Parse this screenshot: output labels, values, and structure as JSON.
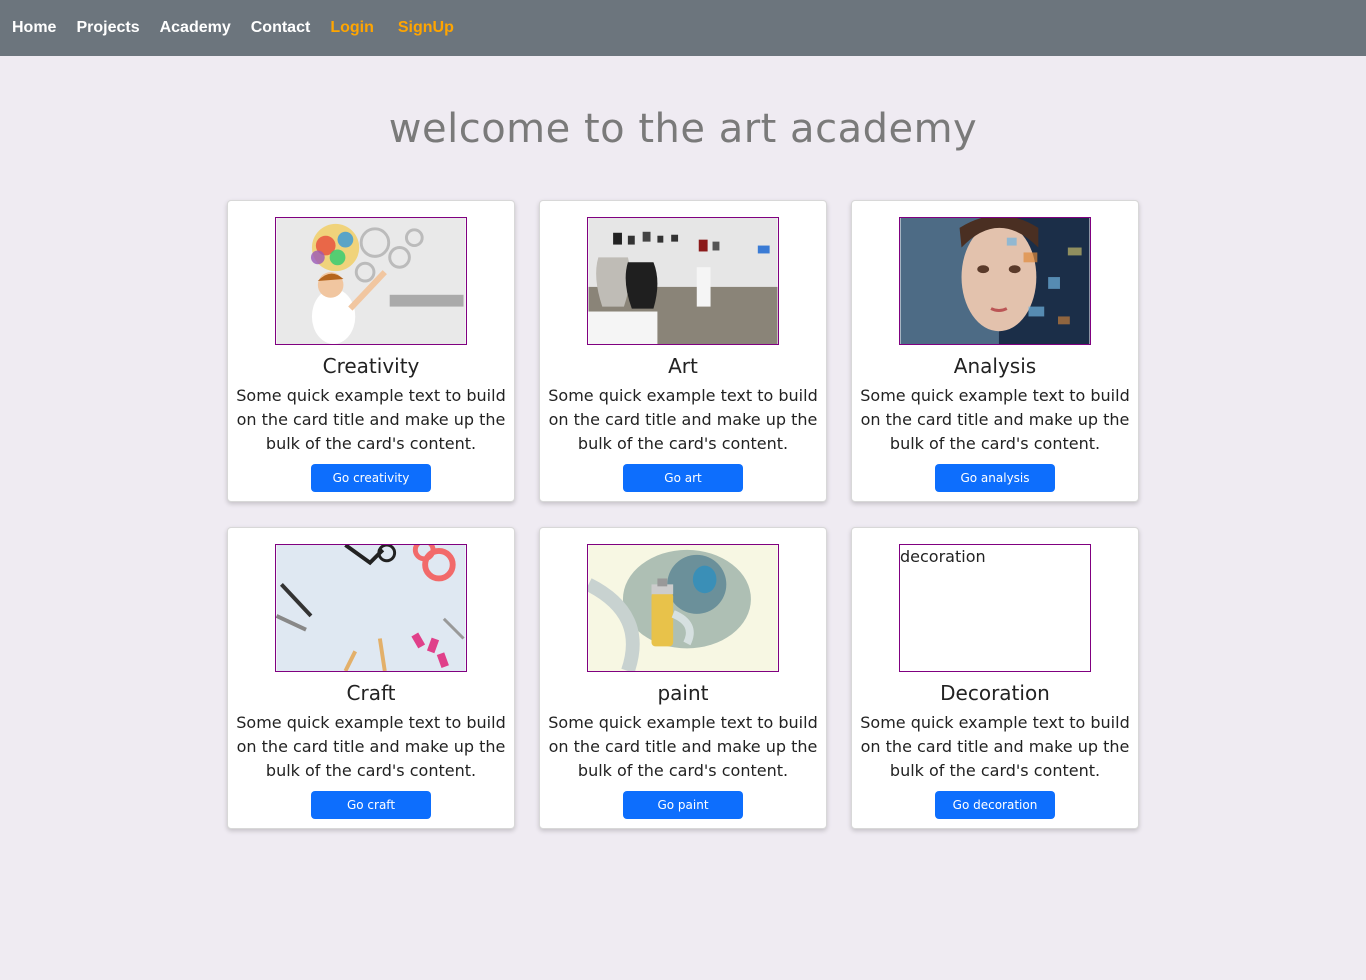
{
  "nav": {
    "items": [
      {
        "label": "Home"
      },
      {
        "label": "Projects"
      },
      {
        "label": "Academy"
      },
      {
        "label": "Contact"
      },
      {
        "label": "Login"
      },
      {
        "label": "SignUp"
      }
    ]
  },
  "page": {
    "title": "welcome to the art academy"
  },
  "cards": [
    {
      "title": "Creativity",
      "text": "Some quick example text to build on the card title and make up the bulk of the card's content.",
      "button": "Go creativity"
    },
    {
      "title": "Art",
      "text": "Some quick example text to build on the card title and make up the bulk of the card's content.",
      "button": "Go art"
    },
    {
      "title": "Analysis",
      "text": "Some quick example text to build on the card title and make up the bulk of the card's content.",
      "button": "Go analysis"
    },
    {
      "title": "Craft",
      "text": "Some quick example text to build on the card title and make up the bulk of the card's content.",
      "button": "Go craft"
    },
    {
      "title": "paint",
      "text": "Some quick example text to build on the card title and make up the bulk of the card's content.",
      "button": "Go paint"
    },
    {
      "title": "Decoration",
      "text": "Some quick example text to build on the card title and make up the bulk of the card's content.",
      "button": "Go decoration",
      "image_alt": "decoration"
    }
  ],
  "colors": {
    "navbar": "#6c757d",
    "nav_accent": "#ffa500",
    "button": "#0d6efd",
    "image_border": "#800080",
    "background": "#efebf2"
  }
}
